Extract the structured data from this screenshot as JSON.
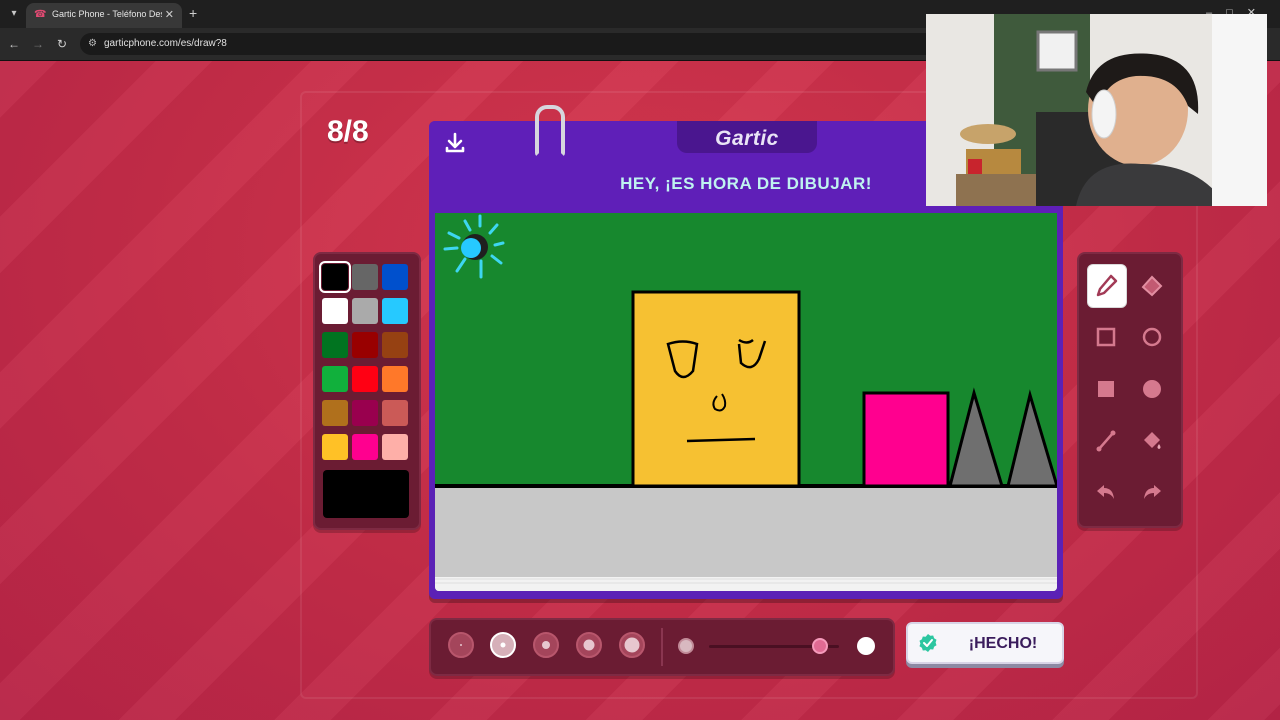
{
  "browser": {
    "tab_title": "Gartic Phone - Teléfono Descon",
    "url": "garticphone.com/es/draw?8"
  },
  "game": {
    "round": "8/8",
    "logo": "Gartic",
    "instruction": "HEY, ¡ES HORA DE DIBUJAR!",
    "done_label": "¡HECHO!"
  },
  "palette": {
    "selected": "#000000",
    "colors": [
      "#000000",
      "#666666",
      "#0050cd",
      "#ffffff",
      "#aaaaaa",
      "#26c9ff",
      "#017420",
      "#990000",
      "#964112",
      "#11b03c",
      "#ff0013",
      "#ff7829",
      "#b0701c",
      "#99004e",
      "#cb5a57",
      "#ffc126",
      "#ff008f",
      "#feafa8"
    ]
  },
  "tools": [
    "pencil-icon",
    "eraser-icon",
    "rectangle-outline-icon",
    "circle-outline-icon",
    "rectangle-filled-icon",
    "circle-filled-icon",
    "line-icon",
    "fill-bucket-icon",
    "undo-icon",
    "redo-icon"
  ],
  "brush": {
    "sizes": 5,
    "selected_size": 2,
    "opacity": 0.85
  }
}
